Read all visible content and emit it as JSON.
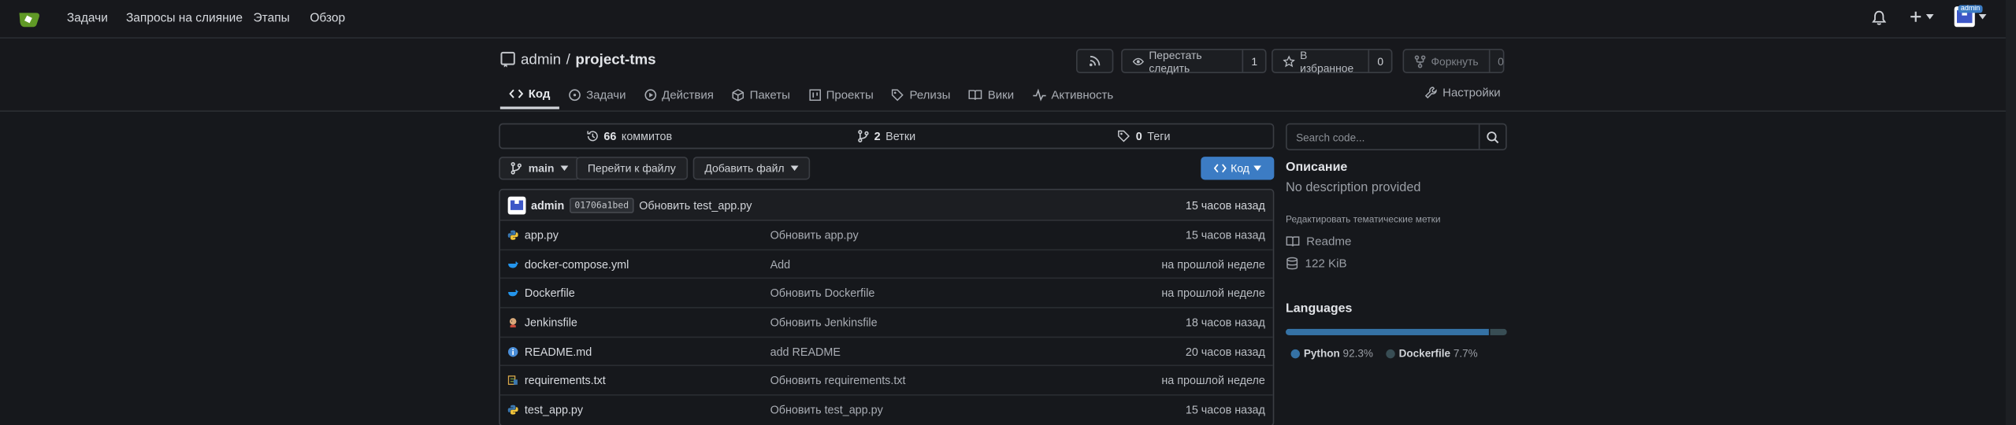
{
  "nav": {
    "items": [
      {
        "label": "Задачи"
      },
      {
        "label": "Запросы на слияние"
      },
      {
        "label": "Этапы"
      },
      {
        "label": "Обзор"
      }
    ],
    "right": {
      "bell_icon": "bell-icon",
      "plus_icon": "plus-icon",
      "avatar_badge": "admin"
    }
  },
  "repo": {
    "owner": "admin",
    "separator": "/",
    "name": "project-tms",
    "watch": {
      "label": "Перестать следить",
      "count": "1"
    },
    "star": {
      "label": "В избранное",
      "count": "0"
    },
    "fork": {
      "label": "Форкнуть",
      "count": "0"
    }
  },
  "tabs": [
    {
      "label": "Код",
      "icon": "code-icon",
      "active": true
    },
    {
      "label": "Задачи",
      "icon": "issue-icon"
    },
    {
      "label": "Действия",
      "icon": "play-icon"
    },
    {
      "label": "Пакеты",
      "icon": "package-icon"
    },
    {
      "label": "Проекты",
      "icon": "project-icon"
    },
    {
      "label": "Релизы",
      "icon": "tag-icon"
    },
    {
      "label": "Вики",
      "icon": "book-icon"
    },
    {
      "label": "Активность",
      "icon": "pulse-icon"
    }
  ],
  "settings_label": "Настройки",
  "stats": {
    "commits_num": "66",
    "commits_label": "коммитов",
    "branches_num": "2",
    "branches_label": "Ветки",
    "tags_num": "0",
    "tags_label": "Теги"
  },
  "toolbar": {
    "branch": "main",
    "goto_file": "Перейти к файлу",
    "add_file": "Добавить файл",
    "code": "Код"
  },
  "last_commit": {
    "author": "admin",
    "sha": "01706a1bed",
    "message": "Обновить test_app.py",
    "time": "15 часов назад"
  },
  "files": [
    {
      "name": "app.py",
      "message": "Обновить app.py",
      "time": "15 часов назад",
      "icon": "python-icon",
      "color": "#3b78b0"
    },
    {
      "name": "docker-compose.yml",
      "message": "Add",
      "time": "на прошлой неделе",
      "icon": "docker-icon",
      "color": "#2496ed"
    },
    {
      "name": "Dockerfile",
      "message": "Обновить Dockerfile",
      "time": "на прошлой неделе",
      "icon": "docker-icon",
      "color": "#2496ed"
    },
    {
      "name": "Jenkinsfile",
      "message": "Обновить Jenkinsfile",
      "time": "18 часов назад",
      "icon": "jenkins-icon",
      "color": "#d8a97a"
    },
    {
      "name": "README.md",
      "message": "add README",
      "time": "20 часов назад",
      "icon": "info-icon",
      "color": "#4a8ed8"
    },
    {
      "name": "requirements.txt",
      "message": "Обновить requirements.txt",
      "time": "на прошлой неделе",
      "icon": "requirements-icon",
      "color": "#6a8f3c"
    },
    {
      "name": "test_app.py",
      "message": "Обновить test_app.py",
      "time": "15 часов назад",
      "icon": "python-icon",
      "color": "#3b78b0"
    }
  ],
  "sidebar": {
    "search_placeholder": "Search code...",
    "description_title": "Описание",
    "description": "No description provided",
    "edit_topics": "Редактировать тематические метки",
    "readme": "Readme",
    "size": "122  KiB",
    "languages_title": "Languages",
    "languages": [
      {
        "name": "Python",
        "percent": "92.3%",
        "value": 92.3,
        "color": "#3572a5"
      },
      {
        "name": "Dockerfile",
        "percent": "7.7%",
        "value": 7.7,
        "color": "#384d54"
      }
    ]
  }
}
